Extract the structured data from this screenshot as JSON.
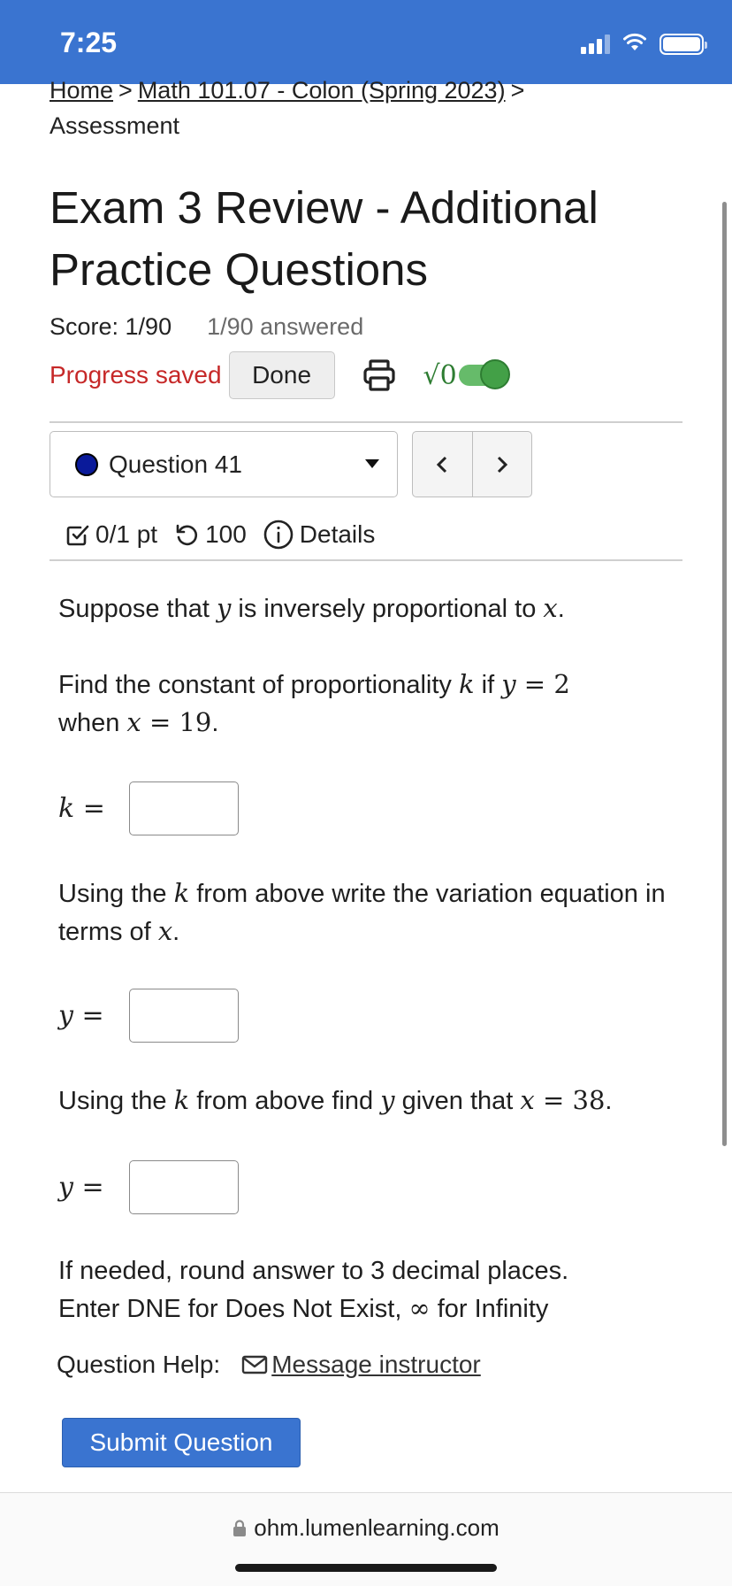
{
  "status_bar": {
    "time": "7:25",
    "icons": [
      "signal-icon",
      "wifi-icon",
      "battery-icon"
    ]
  },
  "breadcrumb": {
    "items": [
      "Home",
      "Math 101.07 - Colon (Spring 2023)",
      "Assessment"
    ],
    "separator": ">"
  },
  "page_title": "Exam 3 Review - Additional Practice Questions",
  "score": {
    "label": "Score: 1/90",
    "answered": "1/90 answered"
  },
  "progress": {
    "status": "Progress saved",
    "done_label": "Done",
    "math_toggle_label": "√0",
    "math_toggle_on": true
  },
  "question_nav": {
    "selected": "Question 41",
    "prev": "<",
    "next": ">"
  },
  "question_meta": {
    "points": "0/1 pt",
    "attempts": "100",
    "details": "Details"
  },
  "question": {
    "p1_a": "Suppose that ",
    "p1_var1": "y",
    "p1_b": " is inversely proportional to ",
    "p1_var2": "x",
    "p1_c": ".",
    "p2_a": "Find the constant of proportionality ",
    "p2_k": "k",
    "p2_b": " if ",
    "p2_y": "y",
    "p2_eq1": " = 2",
    "p2_c": "when ",
    "p2_x": "x",
    "p2_eq2": " = 19",
    "p2_d": ".",
    "ans1_var": "k",
    "ans1_value": "",
    "p3_a": "Using the ",
    "p3_k": "k",
    "p3_b": " from above write the variation equation in terms of ",
    "p3_x": "x",
    "p3_c": ".",
    "ans2_var": "y",
    "ans2_value": "",
    "p4_a": "Using the ",
    "p4_k": "k",
    "p4_b": " from above find ",
    "p4_y": "y",
    "p4_c": " given that ",
    "p4_x": "x",
    "p4_eq": " = 38",
    "p4_d": ".",
    "ans3_var": "y",
    "ans3_value": "",
    "note1": "If needed, round answer to 3 decimal places.",
    "note2_a": "Enter DNE for Does Not Exist, ",
    "note2_inf": "∞",
    "note2_b": " for Infinity"
  },
  "help": {
    "label": "Question Help:",
    "link": "Message instructor"
  },
  "submit_label": "Submit Question",
  "browser": {
    "url": "ohm.lumenlearning.com"
  },
  "colors": {
    "brand_blue": "#3a74d0",
    "progress_red": "#c62828",
    "toggle_green": "#43a047",
    "question_dot": "#0a1a9a"
  }
}
